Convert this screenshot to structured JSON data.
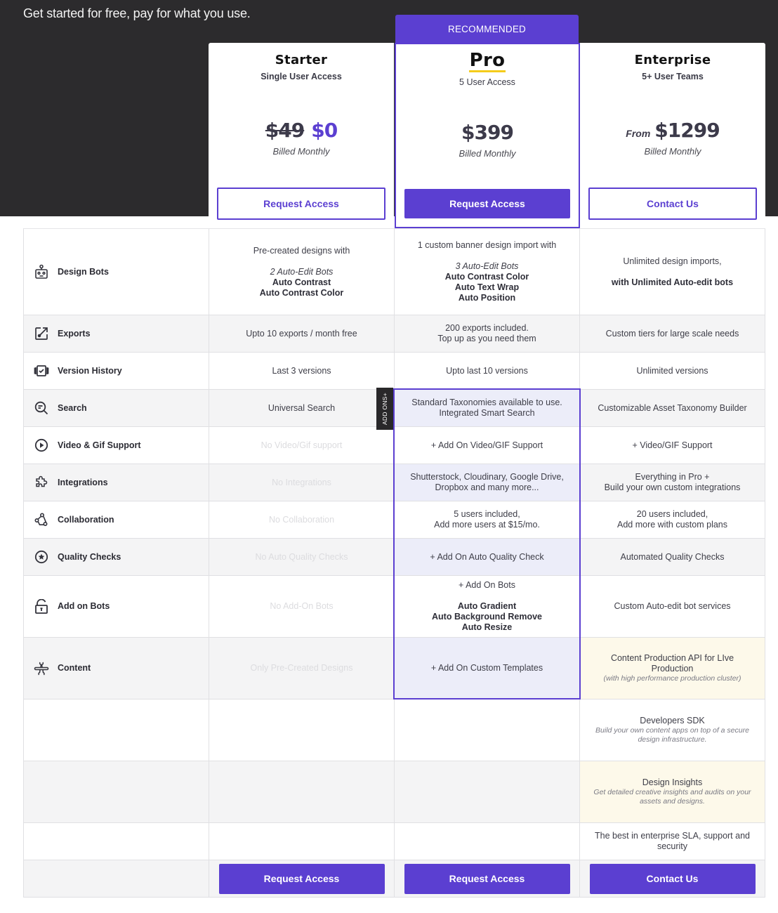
{
  "hero": {
    "tagline": "Get started for free, pay for what you use."
  },
  "colors": {
    "accent": "#5b3fd1",
    "hero_bg": "#2c2b2d",
    "highlight_underline": "#f5cc1b",
    "pro_highlight_bg": "#ecedf9",
    "enterprise_highlight_bg": "#fdf9ea"
  },
  "plans": {
    "recommended_badge": "RECOMMENDED",
    "starter": {
      "name": "Starter",
      "subtitle": "Single User Access",
      "old_price": "$49",
      "price": "$0",
      "billing": "Billed Monthly",
      "cta": "Request Access"
    },
    "pro": {
      "name": "Pro",
      "subtitle": "5 User Access",
      "price": "$399",
      "billing": "Billed Monthly",
      "cta": "Request Access"
    },
    "enterprise": {
      "name": "Enterprise",
      "subtitle": "5+ User Teams",
      "price_prefix": "From",
      "price": "$1299",
      "billing": "Billed Monthly",
      "cta": "Contact Us"
    }
  },
  "addons_tab": "ADD ONS+",
  "features": [
    {
      "icon": "robot-icon",
      "label": "Design Bots",
      "starter": {
        "intro": "Pre-created designs with",
        "italic": "2 Auto-Edit Bots",
        "bold": [
          "Auto Contrast",
          "Auto Contrast Color"
        ]
      },
      "pro": {
        "intro": "1 custom banner design import with",
        "italic": "3 Auto-Edit Bots",
        "bold": [
          "Auto Contrast Color",
          "Auto Text Wrap",
          "Auto Position"
        ]
      },
      "enterprise": {
        "intro": "Unlimited design imports,",
        "bold": [
          "with Unlimited Auto-edit bots"
        ]
      }
    },
    {
      "icon": "export-icon",
      "label": "Exports",
      "starter": {
        "lines": [
          "Upto 10 exports / month free"
        ]
      },
      "pro": {
        "lines": [
          "200 exports included.",
          "Top up as you need them"
        ]
      },
      "enterprise": {
        "lines": [
          "Custom tiers for large scale needs"
        ]
      }
    },
    {
      "icon": "version-history-icon",
      "label": "Version History",
      "starter": {
        "lines": [
          "Last 3 versions"
        ]
      },
      "pro": {
        "lines": [
          "Upto last 10 versions"
        ]
      },
      "enterprise": {
        "lines": [
          "Unlimited versions"
        ]
      }
    },
    {
      "icon": "search-icon",
      "label": "Search",
      "starter": {
        "lines": [
          "Universal Search"
        ]
      },
      "pro": {
        "lines": [
          "Standard Taxonomies available to use.",
          "Integrated Smart Search"
        ]
      },
      "enterprise": {
        "lines": [
          "Customizable Asset Taxonomy Builder"
        ]
      }
    },
    {
      "icon": "play-circle-icon",
      "label": "Video & Gif Support",
      "starter": {
        "lines": [
          "No Video/Gif support"
        ],
        "unavailable": true
      },
      "pro": {
        "lines": [
          "+ Add On Video/GIF Support"
        ]
      },
      "enterprise": {
        "lines": [
          "+ Video/GIF Support"
        ]
      }
    },
    {
      "icon": "puzzle-icon",
      "label": "Integrations",
      "starter": {
        "lines": [
          "No Integrations"
        ],
        "unavailable": true
      },
      "pro": {
        "lines": [
          "Shutterstock, Cloudinary, Google Drive,",
          "Dropbox and many more..."
        ]
      },
      "enterprise": {
        "lines": [
          "Everything in Pro +",
          "Build your own custom integrations"
        ]
      }
    },
    {
      "icon": "collaboration-icon",
      "label": "Collaboration",
      "starter": {
        "lines": [
          "No Collaboration"
        ],
        "unavailable": true
      },
      "pro": {
        "lines": [
          "5 users included,",
          "Add more users at $15/mo."
        ]
      },
      "enterprise": {
        "lines": [
          "20 users included,",
          "Add more with custom plans"
        ]
      }
    },
    {
      "icon": "star-circle-icon",
      "label": "Quality Checks",
      "starter": {
        "lines": [
          "No Auto Quality Checks"
        ],
        "unavailable": true
      },
      "pro": {
        "lines": [
          "+ Add On Auto Quality Check"
        ]
      },
      "enterprise": {
        "lines": [
          "Automated Quality Checks"
        ]
      }
    },
    {
      "icon": "unlock-icon",
      "label": "Add on Bots",
      "starter": {
        "lines": [
          "No Add-On Bots"
        ],
        "unavailable": true
      },
      "pro": {
        "intro": "+ Add On Bots",
        "bold": [
          "Auto Gradient",
          "Auto Background Remove",
          "Auto Resize"
        ]
      },
      "enterprise": {
        "lines": [
          "Custom Auto-edit bot services"
        ]
      }
    },
    {
      "icon": "tools-icon",
      "label": "Content",
      "starter": {
        "lines": [
          "Only Pre-Created Designs"
        ],
        "unavailable": true
      },
      "pro": {
        "lines": [
          "+ Add On Custom Templates"
        ]
      },
      "enterprise": {
        "lines": [
          "Content Production API for LIve",
          "Production"
        ],
        "note": "(with high performance production cluster)"
      }
    }
  ],
  "enterprise_extras": [
    {
      "title": "Developers SDK",
      "note": "Build your own content apps on top of a secure design infrastructure."
    },
    {
      "title": "Design Insights",
      "note": "Get detailed creative insights and audits on your assets and designs."
    },
    {
      "title": "The best in enterprise SLA, support and security"
    }
  ],
  "footer_ctas": {
    "starter": "Request Access",
    "pro": "Request Access",
    "enterprise": "Contact Us"
  }
}
